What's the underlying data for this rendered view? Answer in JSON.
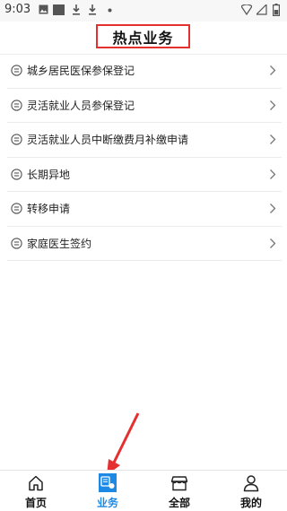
{
  "status_bar": {
    "time": "9:03"
  },
  "header": {
    "title": "热点业务"
  },
  "list": {
    "items": [
      {
        "label": "城乡居民医保参保登记"
      },
      {
        "label": "灵活就业人员参保登记"
      },
      {
        "label": "灵活就业人员中断缴费月补缴申请"
      },
      {
        "label": "长期异地"
      },
      {
        "label": "转移申请"
      },
      {
        "label": "家庭医生签约"
      }
    ]
  },
  "tabbar": {
    "tabs": [
      {
        "label": "首页",
        "icon": "home-icon"
      },
      {
        "label": "业务",
        "icon": "business-icon",
        "active": true
      },
      {
        "label": "全部",
        "icon": "store-icon"
      },
      {
        "label": "我的",
        "icon": "user-icon"
      }
    ]
  },
  "colors": {
    "accent": "#1e88e5",
    "highlight": "#e53030"
  }
}
